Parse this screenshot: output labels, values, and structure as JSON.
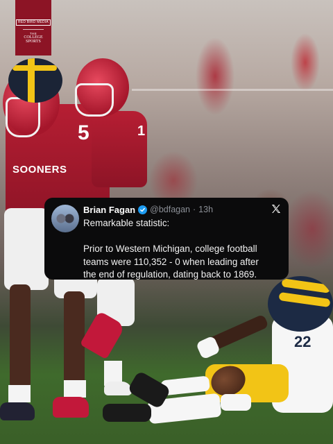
{
  "logo": {
    "top_text": "RED BIRD MEDIA",
    "bottom_text_1": "THE",
    "bottom_text_2": "COLLEGE",
    "bottom_text_3": "SPORTS"
  },
  "photo": {
    "ou_jersey_number": "5",
    "ou_jersey_number_2": "1",
    "ou_chest_text": "SOONERS",
    "wm_jersey_number": "22"
  },
  "tweet": {
    "author_name": "Brian Fagan",
    "handle": "@bdfagan",
    "separator": "·",
    "time": "13h",
    "verified_icon": "verified-badge-icon",
    "platform_icon": "x-logo-icon",
    "line1": "Remarkable statistic:",
    "body_lines": [
      "Prior to Western Michigan, college football",
      "teams were 110,352 - 0 when leading after",
      "the end of regulation, dating back to 1869."
    ]
  },
  "colors": {
    "oklahoma_crimson": "#a5162b",
    "michigan_maize": "#f2c416",
    "michigan_blue": "#1c2a44",
    "tweet_bg": "#0b0b0c",
    "verified_blue": "#1d9bf0"
  }
}
